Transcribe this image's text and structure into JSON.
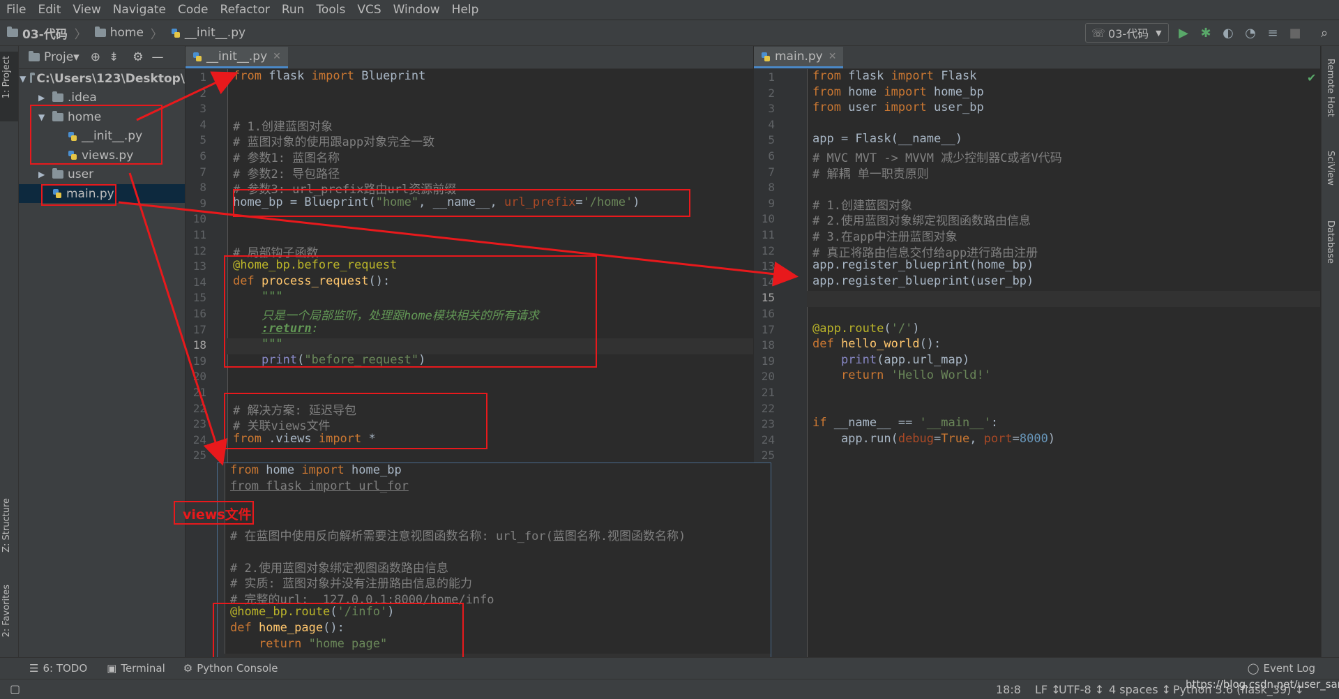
{
  "menu": [
    "File",
    "Edit",
    "View",
    "Navigate",
    "Code",
    "Refactor",
    "Run",
    "Tools",
    "VCS",
    "Window",
    "Help"
  ],
  "breadcrumb": {
    "project": "03-代码",
    "folder": "home",
    "file": "__init__.py"
  },
  "run_config": "03-代码",
  "left_tools": {
    "project": "1: Project",
    "structure": "Z: Structure",
    "favorites": "2: Favorites"
  },
  "right_tools": {
    "remote": "Remote Host",
    "sciview": "SciView",
    "database": "Database"
  },
  "project_panel": {
    "header": "Proje▾",
    "tree": [
      {
        "label": "C:\\Users\\123\\Desktop\\",
        "indent": 0,
        "type": "folder",
        "open": true
      },
      {
        "label": ".idea",
        "indent": 1,
        "type": "folder",
        "open": false
      },
      {
        "label": "home",
        "indent": 1,
        "type": "folder",
        "open": true
      },
      {
        "label": "__init__.py",
        "indent": 2,
        "type": "py"
      },
      {
        "label": "views.py",
        "indent": 2,
        "type": "py"
      },
      {
        "label": "user",
        "indent": 1,
        "type": "folder",
        "open": false
      },
      {
        "label": "main.py",
        "indent": 1,
        "type": "py",
        "selected": true
      }
    ]
  },
  "left_editor": {
    "tab": "__init__.py",
    "lines": [
      "<span class=\"kw\">from</span> flask <span class=\"kw\">import</span> Blueprint",
      "",
      "",
      "<span class=\"cm\"># 1.创建蓝图对象</span>",
      "<span class=\"cm\"># 蓝图对象的使用跟app对象完全一致</span>",
      "<span class=\"cm\"># 参数1: 蓝图名称</span>",
      "<span class=\"cm\"># 参数2: 导包路径</span>",
      "<span class=\"cm\"># 参数3: url_prefix路由url资源前缀</span>",
      "home_bp = Blueprint(<span class=\"str\">\"home\"</span>, __name__, <span class=\"kwarg\">url_prefix</span>=<span class=\"str\">'/home'</span>)",
      "",
      "",
      "<span class=\"cm\"># 局部钩子函数</span>",
      "<span class=\"dec\">@home_bp.before_request</span>",
      "<span class=\"kw\">def</span> <span class=\"fn\">process_request</span>():",
      "    <span class=\"doc\">\"\"\"</span>",
      "    <span class=\"doc\">只是一个局部监听，处理跟home模块相关的所有请求</span>",
      "    <span class=\"doc\"><b><u>:return</u></b>:</span>",
      "    <span class=\"doc\">\"\"\"</span>",
      "    <span class=\"pr\">print</span>(<span class=\"str\">\"before_request\"</span>)",
      "",
      "",
      "<span class=\"cm\"># 解决方案: 延迟导包</span>",
      "<span class=\"cm\"># 关联views文件</span>",
      "<span class=\"kw\">from</span> .views <span class=\"kw\">import</span> *",
      ""
    ]
  },
  "right_editor": {
    "tab": "main.py",
    "lines": [
      "<span class=\"kw\">from</span> flask <span class=\"kw\">import</span> Flask",
      "<span class=\"kw\">from</span> home <span class=\"kw\">import</span> home_bp",
      "<span class=\"kw\">from</span> user <span class=\"kw\">import</span> user_bp",
      "",
      "app = Flask(__name__)",
      "<span class=\"cm\"># MVC MVT -&gt; MVVM 减少控制器C或者V代码</span>",
      "<span class=\"cm\"># 解耦 单一职责原则</span>",
      "",
      "<span class=\"cm\"># 1.创建蓝图对象</span>",
      "<span class=\"cm\"># 2.使用蓝图对象绑定视图函数路由信息</span>",
      "<span class=\"cm\"># 3.在app中注册蓝图对象</span>",
      "<span class=\"cm\"># 真正将路由信息交付给app进行路由注册</span>",
      "app.register_blueprint(home_bp)",
      "app.register_blueprint(user_bp)",
      "",
      "",
      "<span class=\"dec\">@app.route</span>(<span class=\"str\">'/'</span>)",
      "<span class=\"kw\">def</span> <span class=\"fn\">hello_world</span>():",
      "    <span class=\"pr\">print</span>(app.url_map)",
      "    <span class=\"kw\">return</span> <span class=\"str\">'Hello World!'</span>",
      "",
      "",
      "<span class=\"kw\">if</span> __name__ == <span class=\"str\">'__main__'</span>:",
      "    app.run(<span class=\"kwarg\">debug</span>=<span class=\"kw\">True</span>, <span class=\"kwarg\">port</span>=<span class=\"num\">8000</span>)",
      ""
    ]
  },
  "views_popup": {
    "lines": [
      "<span class=\"kw\">from</span> home <span class=\"kw\">import</span> home_bp",
      "<span class=\"cm\" style=\"text-decoration:underline\">from flask import url_for</span>",
      "",
      "",
      "<span class=\"cm\"># 在蓝图中使用反向解析需要注意视图函数名称: url_for(蓝图名称.视图函数名称)</span>",
      "",
      "<span class=\"cm\"># 2.使用蓝图对象绑定视图函数路由信息</span>",
      "<span class=\"cm\"># 实质: 蓝图对象并没有注册路由信息的能力</span>",
      "<span class=\"cm\"># 完整的url:  127.0.0.1:8000/home/info</span>",
      "<span class=\"dec\">@home_bp.route</span>(<span class=\"str\">'/info'</span>)",
      "<span class=\"kw\">def</span> <span class=\"fn\">home_page</span>():",
      "    <span class=\"kw\">return</span> <span class=\"str\">\"home page\"</span>",
      ""
    ]
  },
  "annotation_label": "views文件",
  "bottom_tools": [
    "6: TODO",
    "Terminal",
    "Python Console"
  ],
  "event_log": "Event Log",
  "status": {
    "position": "18:8",
    "line_sep": "LF ↕",
    "encoding": "UTF-8 ↕",
    "indent": "4 spaces ↕",
    "interpreter": "Python 3.6 (flask_39) ↕",
    "url": "https://blog.csdn.net/user_san"
  },
  "colors": {
    "annotation_red": "#e8191c",
    "keyword": "#cc7832",
    "string": "#6a8759",
    "comment": "#808080"
  }
}
